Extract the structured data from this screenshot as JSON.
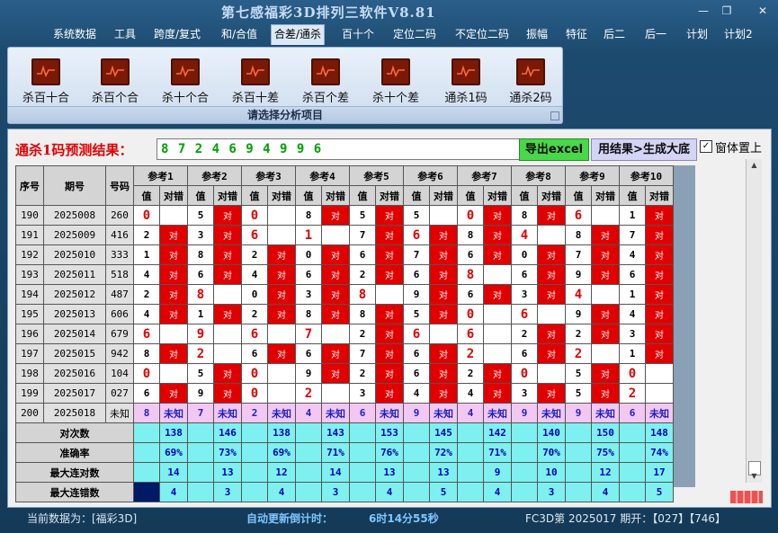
{
  "window": {
    "title": "第七感福彩3D排列三软件V8.81",
    "min": "—",
    "restore": "❐",
    "close": "✕"
  },
  "menu": [
    "系统数据",
    "工具",
    "跨度/复式",
    "和/合值",
    "合差/通杀",
    "百十个",
    "定位二码",
    "不定位二码",
    "振幅",
    "特征",
    "后二",
    "后一",
    "计划",
    "计划2"
  ],
  "menu_active_index": 4,
  "ribbon": {
    "buttons": [
      "杀百十合",
      "杀百个合",
      "杀十个合",
      "杀百十差",
      "杀百个差",
      "杀十个差",
      "通杀1码",
      "通杀2码"
    ],
    "group_label": "请选择分析项目"
  },
  "prediction": {
    "label": "通杀1码预测结果：",
    "value": "8 7 2 4 6 9 4 9 9 6",
    "export_button": "导出excel",
    "generate_button": "用结果>生成大底",
    "checkbox_label": "窗体置上"
  },
  "grid": {
    "headers": {
      "seq": "序号",
      "issue": "期号",
      "number": "号码",
      "refs": [
        "参考1",
        "参考2",
        "参考3",
        "参考4",
        "参考5",
        "参考6",
        "参考7",
        "参考8",
        "参考9",
        "参考10"
      ],
      "value": "值",
      "check": "对错"
    },
    "hit_text": "对",
    "rows": [
      {
        "seq": "190",
        "issue": "2025008",
        "num": "260",
        "vals": [
          "0",
          "5",
          "0",
          "8",
          "5",
          "5",
          "0",
          "8",
          "6",
          "1"
        ],
        "hits": [
          0,
          1,
          0,
          1,
          1,
          0,
          1,
          1,
          0,
          1
        ]
      },
      {
        "seq": "191",
        "issue": "2025009",
        "num": "416",
        "vals": [
          "2",
          "3",
          "6",
          "1",
          "7",
          "6",
          "8",
          "4",
          "8",
          "7"
        ],
        "hits": [
          1,
          1,
          0,
          0,
          1,
          1,
          1,
          0,
          1,
          1
        ]
      },
      {
        "seq": "192",
        "issue": "2025010",
        "num": "333",
        "vals": [
          "1",
          "8",
          "2",
          "0",
          "6",
          "7",
          "6",
          "0",
          "7",
          "4"
        ],
        "hits": [
          1,
          1,
          1,
          1,
          1,
          1,
          1,
          1,
          1,
          1
        ]
      },
      {
        "seq": "193",
        "issue": "2025011",
        "num": "518",
        "vals": [
          "4",
          "6",
          "4",
          "6",
          "2",
          "6",
          "8",
          "6",
          "9",
          "6"
        ],
        "hits": [
          1,
          1,
          1,
          1,
          1,
          1,
          0,
          1,
          1,
          1
        ]
      },
      {
        "seq": "194",
        "issue": "2025012",
        "num": "487",
        "vals": [
          "2",
          "8",
          "0",
          "3",
          "8",
          "9",
          "6",
          "3",
          "4",
          "1"
        ],
        "hits": [
          1,
          0,
          1,
          1,
          0,
          1,
          1,
          1,
          0,
          1
        ]
      },
      {
        "seq": "195",
        "issue": "2025013",
        "num": "606",
        "vals": [
          "4",
          "1",
          "2",
          "8",
          "8",
          "5",
          "0",
          "6",
          "9",
          "4"
        ],
        "hits": [
          1,
          1,
          1,
          1,
          1,
          1,
          0,
          0,
          1,
          1
        ]
      },
      {
        "seq": "196",
        "issue": "2025014",
        "num": "679",
        "vals": [
          "6",
          "9",
          "6",
          "7",
          "2",
          "6",
          "6",
          "2",
          "2",
          "3"
        ],
        "hits": [
          0,
          0,
          0,
          0,
          1,
          0,
          0,
          1,
          1,
          1
        ]
      },
      {
        "seq": "197",
        "issue": "2025015",
        "num": "942",
        "vals": [
          "8",
          "2",
          "6",
          "6",
          "7",
          "6",
          "2",
          "6",
          "2",
          "1"
        ],
        "hits": [
          1,
          0,
          1,
          1,
          1,
          1,
          0,
          1,
          0,
          1
        ]
      },
      {
        "seq": "198",
        "issue": "2025016",
        "num": "104",
        "vals": [
          "0",
          "5",
          "0",
          "9",
          "2",
          "6",
          "2",
          "0",
          "5",
          "0"
        ],
        "hits": [
          0,
          1,
          0,
          1,
          1,
          1,
          1,
          0,
          1,
          0
        ]
      },
      {
        "seq": "199",
        "issue": "2025017",
        "num": "027",
        "vals": [
          "6",
          "9",
          "0",
          "2",
          "3",
          "4",
          "4",
          "3",
          "5",
          "2"
        ],
        "hits": [
          1,
          1,
          0,
          0,
          1,
          1,
          1,
          1,
          1,
          0
        ]
      },
      {
        "seq": "200",
        "issue": "2025018",
        "num": "未知",
        "vals": [
          "8",
          "7",
          "2",
          "4",
          "6",
          "9",
          "4",
          "9",
          "9",
          "6"
        ],
        "unknown": "未知"
      }
    ],
    "value_red": [
      [
        1,
        0,
        1,
        0,
        0,
        0,
        1,
        0,
        1,
        0
      ],
      [
        0,
        0,
        1,
        1,
        0,
        1,
        0,
        1,
        0,
        0
      ],
      [
        0,
        0,
        0,
        0,
        0,
        0,
        0,
        0,
        0,
        0
      ],
      [
        0,
        0,
        0,
        0,
        0,
        0,
        1,
        0,
        0,
        0
      ],
      [
        0,
        1,
        0,
        0,
        1,
        0,
        0,
        0,
        1,
        0
      ],
      [
        0,
        0,
        0,
        0,
        0,
        0,
        1,
        1,
        0,
        0
      ],
      [
        1,
        1,
        1,
        1,
        0,
        1,
        1,
        0,
        0,
        0
      ],
      [
        0,
        1,
        0,
        0,
        0,
        0,
        1,
        0,
        1,
        0
      ],
      [
        1,
        0,
        1,
        0,
        0,
        0,
        0,
        1,
        0,
        1
      ],
      [
        0,
        0,
        1,
        1,
        0,
        0,
        0,
        0,
        0,
        1
      ]
    ],
    "stats": [
      {
        "label": "对次数",
        "values": [
          "138",
          "146",
          "138",
          "143",
          "153",
          "145",
          "142",
          "140",
          "150",
          "148"
        ]
      },
      {
        "label": "准确率",
        "values": [
          "69%",
          "73%",
          "69%",
          "71%",
          "76%",
          "72%",
          "71%",
          "70%",
          "75%",
          "74%"
        ]
      },
      {
        "label": "最大连对数",
        "values": [
          "14",
          "13",
          "12",
          "14",
          "13",
          "13",
          "9",
          "10",
          "12",
          "17"
        ]
      },
      {
        "label": "最大连错数",
        "values": [
          "4",
          "3",
          "4",
          "3",
          "4",
          "5",
          "4",
          "3",
          "4",
          "5"
        ]
      }
    ]
  },
  "status": {
    "current": "当前数据为：[福彩3D]",
    "countdown_label": "自动更新倒计时：",
    "countdown_value": "6时14分55秒",
    "draw": "FC3D第 2025017 期开：【027】【746】"
  }
}
